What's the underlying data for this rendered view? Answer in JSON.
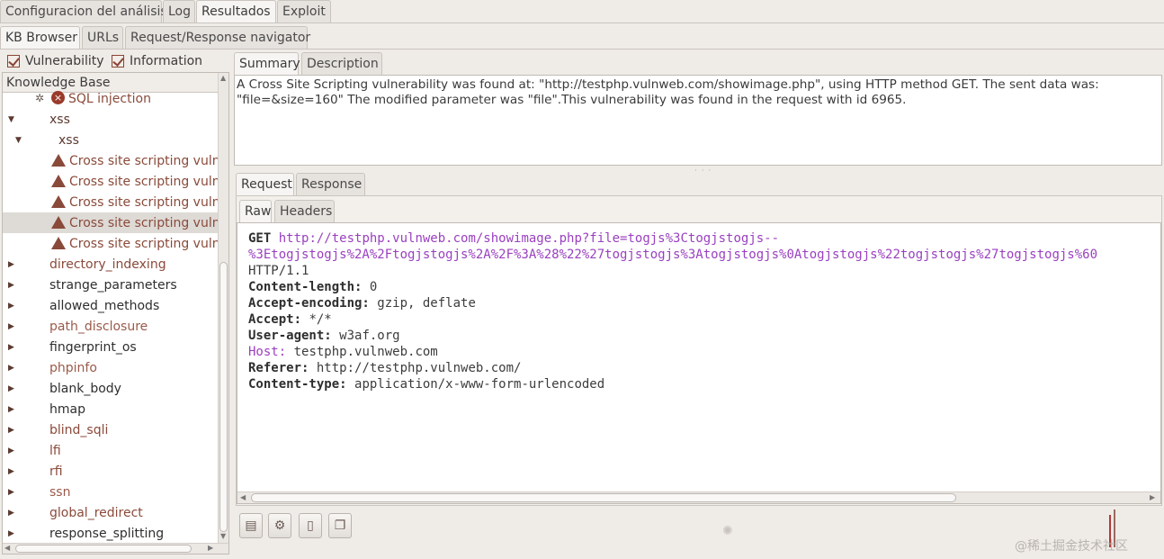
{
  "main_tabs": [
    "Configuracion del análisis",
    "Log",
    "Resultados",
    "Exploit"
  ],
  "sub_tabs": [
    "KB Browser",
    "URLs",
    "Request/Response navigator"
  ],
  "filters": {
    "vulnerability": "Vulnerability",
    "information": "Information"
  },
  "tree": {
    "header": "Knowledge Base",
    "items": [
      {
        "label": "SQL injection"
      },
      {
        "label": "xss"
      },
      {
        "label": "xss"
      },
      {
        "label": "Cross site scripting vulnerability"
      },
      {
        "label": "Cross site scripting vulnerability"
      },
      {
        "label": "Cross site scripting vulnerability"
      },
      {
        "label": "Cross site scripting vulnerability"
      },
      {
        "label": "Cross site scripting vulnerability"
      },
      {
        "label": "directory_indexing"
      },
      {
        "label": "strange_parameters"
      },
      {
        "label": "allowed_methods"
      },
      {
        "label": "path_disclosure"
      },
      {
        "label": "fingerprint_os"
      },
      {
        "label": "phpinfo"
      },
      {
        "label": "blank_body"
      },
      {
        "label": "hmap"
      },
      {
        "label": "blind_sqli"
      },
      {
        "label": "lfi"
      },
      {
        "label": "rfi"
      },
      {
        "label": "ssn"
      },
      {
        "label": "global_redirect"
      },
      {
        "label": "response_splitting"
      }
    ]
  },
  "detail_tabs": [
    "Summary",
    "Description"
  ],
  "summary": {
    "line1": "A Cross Site Scripting vulnerability was found at: \"http://testphp.vulnweb.com/showimage.php\", using HTTP method GET. The sent data was:",
    "line2": "\"file=&size=160\" The modified parameter was \"file\".This vulnerability was found in the request with id 6965."
  },
  "reqresp_tabs": [
    "Request",
    "Response"
  ],
  "view_tabs": [
    "Raw",
    "Headers"
  ],
  "request": {
    "method": "GET",
    "url_line1": "http://testphp.vulnweb.com/showimage.php?file=togjs%3Ctogjstogjs--",
    "url_line2": "%3Etogjstogjs%2A%2Ftogjstogjs%2A%2F%3A%28%22%27togjstogjs%3Atogjstogjs%0Atogjstogjs%22togjstogjs%27togjstogjs%60",
    "protocol": "HTTP/1.1",
    "headers": [
      {
        "name": "Content-length:",
        "value": "0"
      },
      {
        "name": "Accept-encoding:",
        "value": "gzip, deflate"
      },
      {
        "name": "Accept:",
        "value": "*/*"
      },
      {
        "name": "User-agent:",
        "value": "w3af.org"
      },
      {
        "name": "Host:",
        "value": "testphp.vulnweb.com"
      },
      {
        "name": "Referer:",
        "value": "http://testphp.vulnweb.com/"
      },
      {
        "name": "Content-type:",
        "value": "application/x-www-form-urlencoded"
      }
    ]
  },
  "watermark": "@稀土掘金技术社区",
  "colors": {
    "accent_purple": "#9a40c0",
    "vuln_red": "#8a4a3a",
    "window_bg": "#efebe7"
  }
}
